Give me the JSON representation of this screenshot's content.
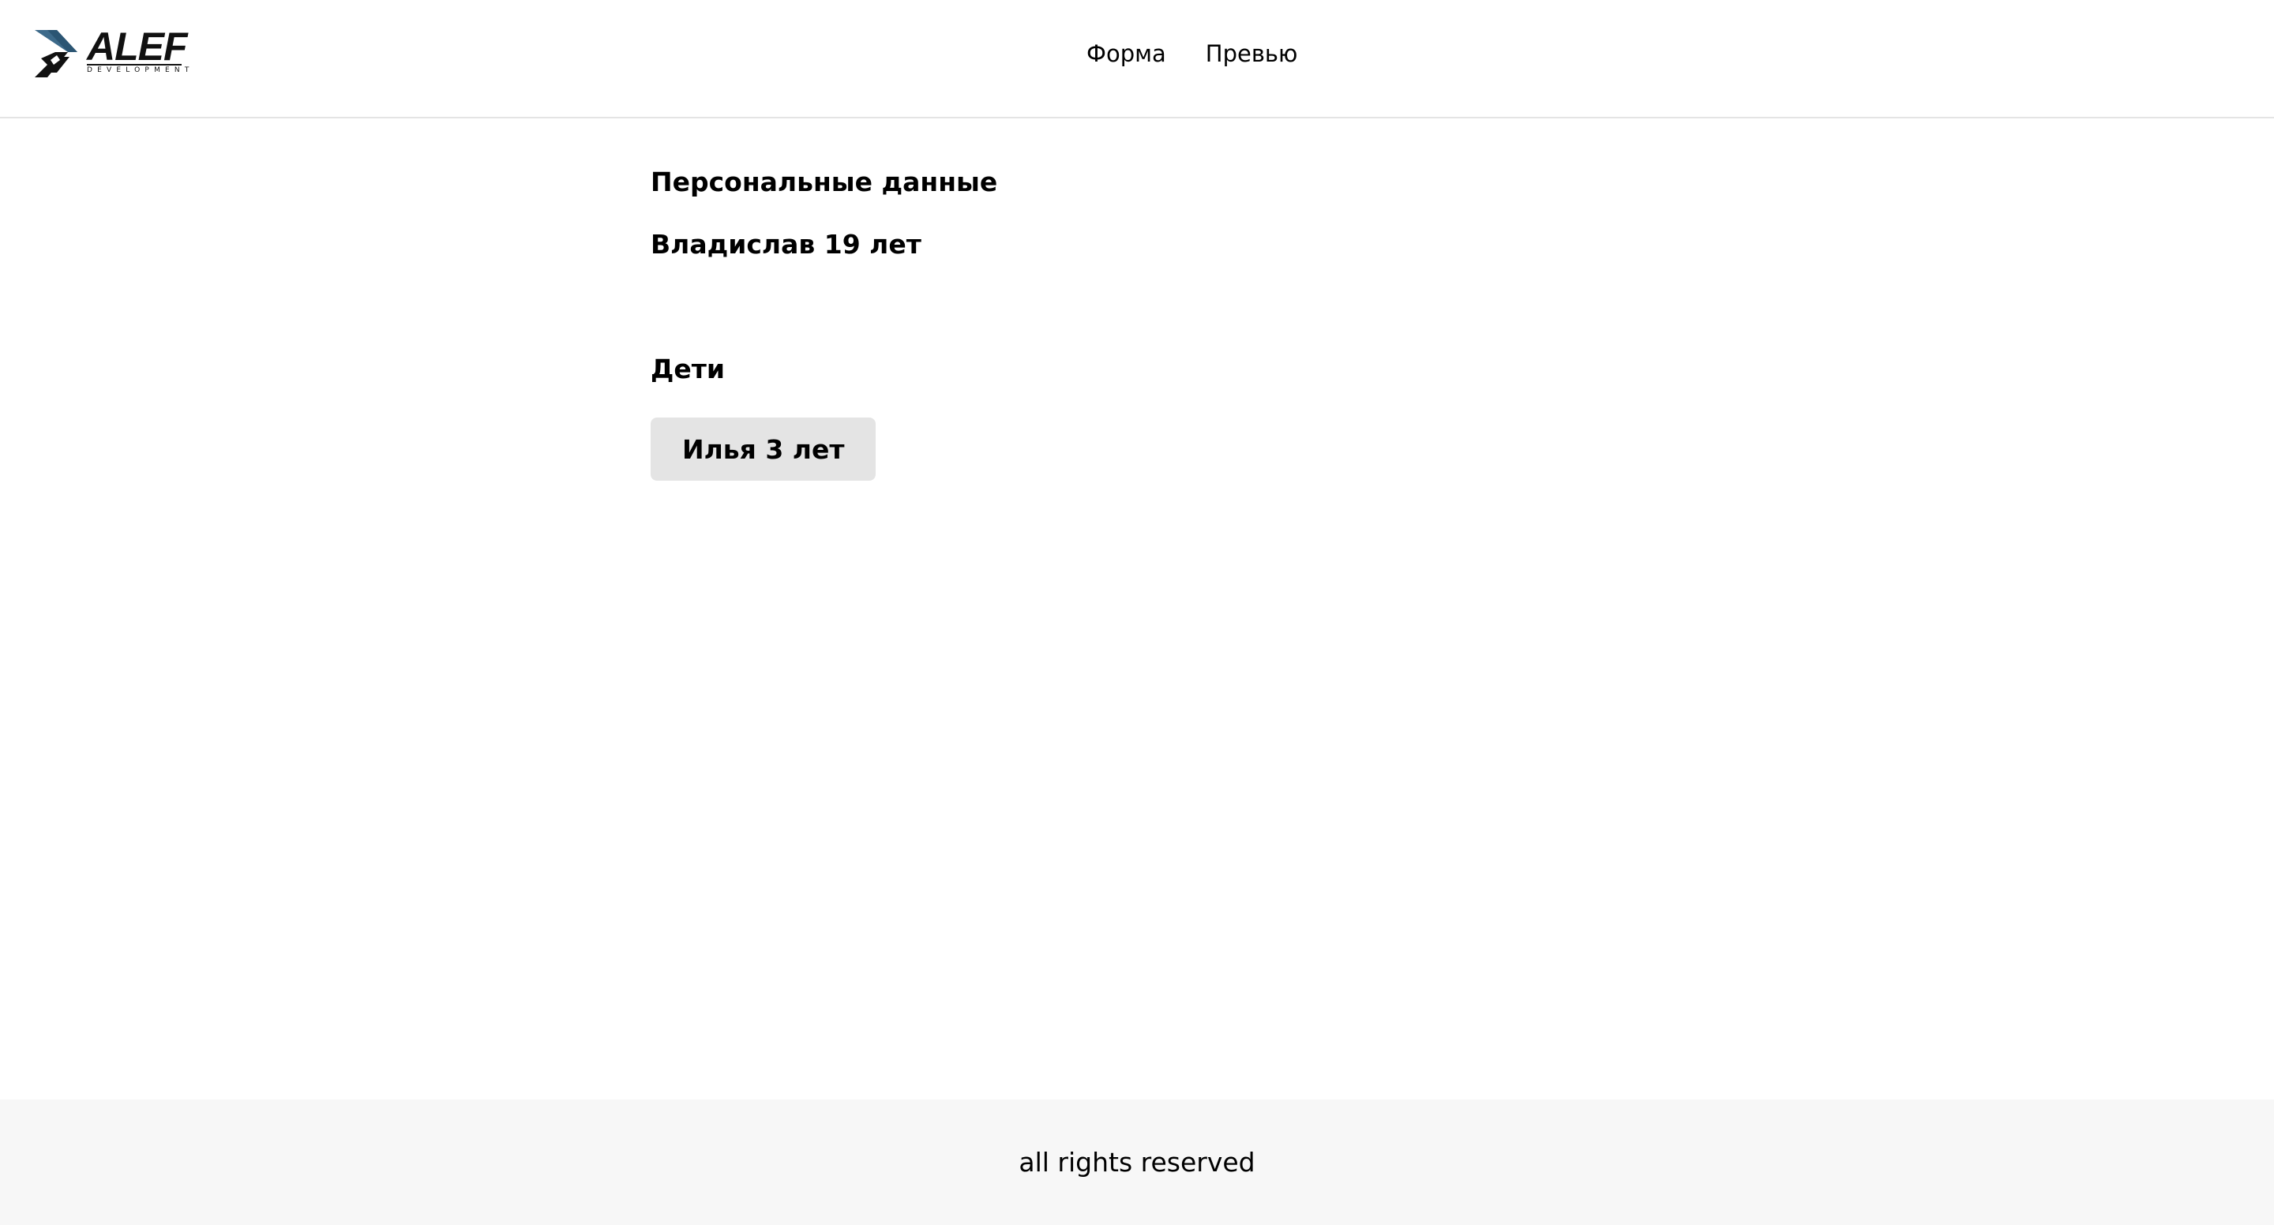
{
  "header": {
    "logo": {
      "name": "ALEF",
      "sub": "DEVELOPMENT",
      "colors": {
        "blue": "#3d6a8a",
        "dark": "#111111"
      }
    },
    "nav": [
      {
        "label": "Форма"
      },
      {
        "label": "Превью"
      }
    ]
  },
  "main": {
    "personal": {
      "title": "Персональные данные",
      "summary": "Владислав 19 лет"
    },
    "children": {
      "title": "Дети",
      "items": [
        {
          "label": "Илья 3 лет"
        }
      ]
    }
  },
  "footer": {
    "text": "all rights reserved"
  }
}
